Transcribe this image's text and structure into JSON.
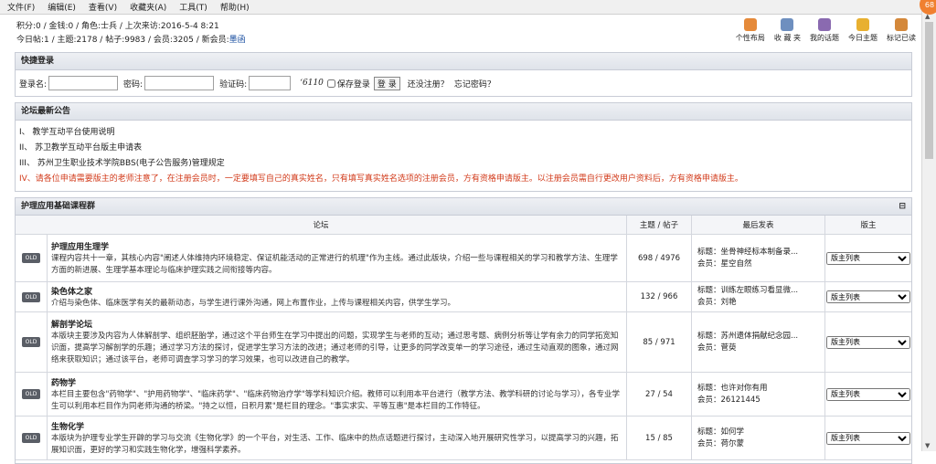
{
  "menu": [
    "文件(F)",
    "编辑(E)",
    "查看(V)",
    "收藏夹(A)",
    "工具(T)",
    "帮助(H)"
  ],
  "notif_count": "68",
  "stats": {
    "line1": "积分:0 / 金钱:0 / 角色:士兵 / 上次来访:2016-5-4 8:21",
    "line2_prefix": "今日帖:1 / 主题:2178 / 帖子:9983 / 会员:3205 / 新会员:",
    "newest_member": "墨函"
  },
  "quick_links": [
    "个性布局",
    "收 藏 夹",
    "我的话题",
    "今日主题",
    "标记已读"
  ],
  "login": {
    "title": "快捷登录",
    "user_label": "登录名:",
    "pass_label": "密码:",
    "captcha_label": "验证码:",
    "captcha_text": "‘6110",
    "remember_label": "保存登录",
    "login_button": "登 录",
    "register_text": "还没注册？",
    "forgot_text": "忘记密码？"
  },
  "notice": {
    "title": "论坛最新公告",
    "items": [
      "I、 教学互动平台使用说明",
      "II、 苏卫教学互动平台版主申请表",
      "III、 苏州卫生职业技术学院BBS(电子公告服务)管理规定",
      "IV、请各位申请需要版主的老师注意了，在注册会员时，一定要填写自己的真实姓名，只有填写真实姓名选项的注册会员，方有资格申请版主。以注册会员需自行更改用户资料后，方有资格申请版主。"
    ]
  },
  "forum": {
    "title": "护理应用基础课程群",
    "collapse_icon": "⊟",
    "columns": [
      "论坛",
      "主题 / 帖子",
      "最后发表",
      "版主"
    ],
    "moderator_select": "版主列表",
    "icon_label": "OLD",
    "rows": [
      {
        "title": "护理应用生理学",
        "desc": "课程内容共十一章，其核心内容\"阐述人体维持内环境稳定、保证机能活动的正常进行的机理\"作为主线。通过此版块，介绍一些与课程相关的学习和教学方法、生理学方面的新进展、生理学基本理论与临床护理实践之间衔接等内容。",
        "count": "698 / 4976",
        "last_title": "标题：坐骨神经标本制备录...",
        "last_member": "会员：星空自然"
      },
      {
        "title": "染色体之家",
        "desc": "介绍与染色体、临床医学有关的最新动态，与学生进行课外沟通，网上布置作业，上传与课程相关内容，供学生学习。",
        "count": "132 / 966",
        "last_title": "标题：训练左眼练习看显微...",
        "last_member": "会员：刘艳"
      },
      {
        "title": "解剖学论坛",
        "desc": "本版块主要涉及内容为人体解剖学、组织胚胎学，通过这个平台师生在学习中提出的问题，实现学生与老师的互动；通过思考题、病例分析等让学有余力的同学拓宽知识面，提高学习解剖学的乐趣；通过学习方法的探讨，促进学生学习方法的改进；通过老师的引导，让更多的同学改变单一的学习途径，通过生动直观的图象，通过网络来获取知识；通过该平台，老师可调查学习学习的学习效果，也可以改进自己的教学。",
        "count": "85 / 971",
        "last_title": "标题：苏州遗体捐献纪念园...",
        "last_member": "会员：菅萸"
      },
      {
        "title": "药物学",
        "desc": "本栏目主要包含\"药物学\"、\"护用药物学\"、\"临床药学\"、\"临床药物治疗学\"等学科知识介绍。教师可以利用本平台进行（教学方法、教学科研的讨论与学习），各专业学生可以利用本栏目作为同老师沟通的桥梁。\"持之以恒，日积月累\"是栏目的理念。\"事实求实、平等互惠\"是本栏目的工作特征。",
        "count": "27 / 54",
        "last_title": "标题：也许对你有用",
        "last_member": "会员：26121445"
      },
      {
        "title": "生物化学",
        "desc": "本版块为护理专业学生开辟的学习与交流《生物化学》的一个平台，对生活、工作、临床中的热点话题进行探讨，主动深入地开展研究性学习，以提高学习的兴趣，拓展知识面，更好的学习和实践生物化学，增强科学素养。",
        "count": "15 / 85",
        "last_title": "标题：如何学",
        "last_member": "会员：荷尔蒙"
      }
    ]
  }
}
